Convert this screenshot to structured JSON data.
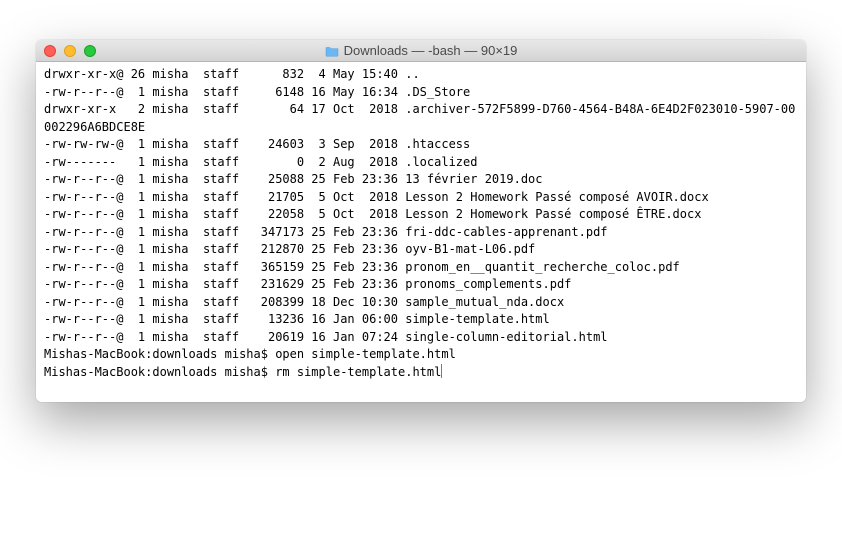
{
  "window": {
    "title": "Downloads — -bash — 90×19"
  },
  "listing": [
    {
      "perm": "drwxr-xr-x@",
      "links": "26",
      "owner": "misha",
      "group": "staff",
      "size": "832",
      "date": " 4 May 15:40",
      "name": ".."
    },
    {
      "perm": "-rw-r--r--@",
      "links": " 1",
      "owner": "misha",
      "group": "staff",
      "size": "6148",
      "date": "16 May 16:34",
      "name": ".DS_Store"
    },
    {
      "perm": "drwxr-xr-x ",
      "links": " 2",
      "owner": "misha",
      "group": "staff",
      "size": "64",
      "date": "17 Oct  2018",
      "name": ".archiver-572F5899-D760-4564-B48A-6E4D2F023010-5907-00002296A6BDCE8E"
    },
    {
      "perm": "-rw-rw-rw-@",
      "links": " 1",
      "owner": "misha",
      "group": "staff",
      "size": "24603",
      "date": " 3 Sep  2018",
      "name": ".htaccess"
    },
    {
      "perm": "-rw------- ",
      "links": " 1",
      "owner": "misha",
      "group": "staff",
      "size": "0",
      "date": " 2 Aug  2018",
      "name": ".localized"
    },
    {
      "perm": "-rw-r--r--@",
      "links": " 1",
      "owner": "misha",
      "group": "staff",
      "size": "25088",
      "date": "25 Feb 23:36",
      "name": "13 février 2019.doc"
    },
    {
      "perm": "-rw-r--r--@",
      "links": " 1",
      "owner": "misha",
      "group": "staff",
      "size": "21705",
      "date": " 5 Oct  2018",
      "name": "Lesson 2 Homework Passé composé AVOIR.docx"
    },
    {
      "perm": "-rw-r--r--@",
      "links": " 1",
      "owner": "misha",
      "group": "staff",
      "size": "22058",
      "date": " 5 Oct  2018",
      "name": "Lesson 2 Homework Passé composé ÊTRE.docx"
    },
    {
      "perm": "-rw-r--r--@",
      "links": " 1",
      "owner": "misha",
      "group": "staff",
      "size": "347173",
      "date": "25 Feb 23:36",
      "name": "fri-ddc-cables-apprenant.pdf"
    },
    {
      "perm": "-rw-r--r--@",
      "links": " 1",
      "owner": "misha",
      "group": "staff",
      "size": "212870",
      "date": "25 Feb 23:36",
      "name": "oyv-B1-mat-L06.pdf"
    },
    {
      "perm": "-rw-r--r--@",
      "links": " 1",
      "owner": "misha",
      "group": "staff",
      "size": "365159",
      "date": "25 Feb 23:36",
      "name": "pronom_en__quantit_recherche_coloc.pdf"
    },
    {
      "perm": "-rw-r--r--@",
      "links": " 1",
      "owner": "misha",
      "group": "staff",
      "size": "231629",
      "date": "25 Feb 23:36",
      "name": "pronoms_complements.pdf"
    },
    {
      "perm": "-rw-r--r--@",
      "links": " 1",
      "owner": "misha",
      "group": "staff",
      "size": "208399",
      "date": "18 Dec 10:30",
      "name": "sample_mutual_nda.docx"
    },
    {
      "perm": "-rw-r--r--@",
      "links": " 1",
      "owner": "misha",
      "group": "staff",
      "size": "13236",
      "date": "16 Jan 06:00",
      "name": "simple-template.html"
    },
    {
      "perm": "-rw-r--r--@",
      "links": " 1",
      "owner": "misha",
      "group": "staff",
      "size": "20619",
      "date": "16 Jan 07:24",
      "name": "single-column-editorial.html"
    }
  ],
  "prompts": [
    {
      "prefix": "Mishas-MacBook:downloads misha$ ",
      "command": "open simple-template.html"
    },
    {
      "prefix": "Mishas-MacBook:downloads misha$ ",
      "command": "rm simple-template.html"
    }
  ]
}
